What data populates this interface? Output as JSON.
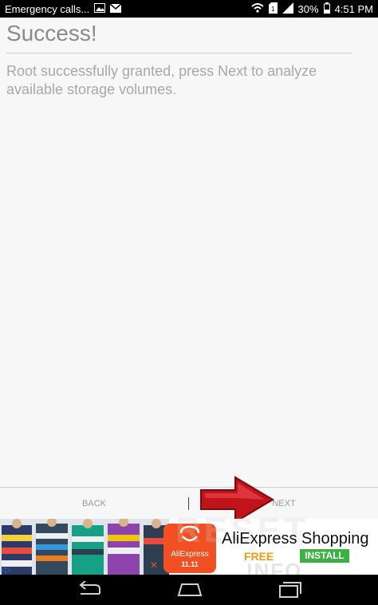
{
  "status_bar": {
    "carrier_text": "Emergency calls...",
    "battery": "30%",
    "time": "4:51 PM",
    "icons": [
      "gallery-icon",
      "mail-icon",
      "wifi-icon",
      "sim-icon",
      "signal-icon",
      "battery-icon"
    ]
  },
  "page": {
    "title": "Success!",
    "message": "Root successfully granted, press Next to analyze available storage volumes."
  },
  "buttons": {
    "back_label": "BACK",
    "next_label": "NEXT"
  },
  "ad": {
    "app_title": "AliExpress Shopping",
    "free_label": "FREE",
    "install_label": "INSTALL",
    "logo_text": "AliExpress",
    "logo_sub": "11.11",
    "choices": "i ▷",
    "brand_color": "#f25022",
    "install_color": "#3cb043",
    "free_color": "#f39c12"
  },
  "navbar": {
    "icons": [
      "back-icon",
      "home-icon",
      "recents-icon"
    ]
  }
}
